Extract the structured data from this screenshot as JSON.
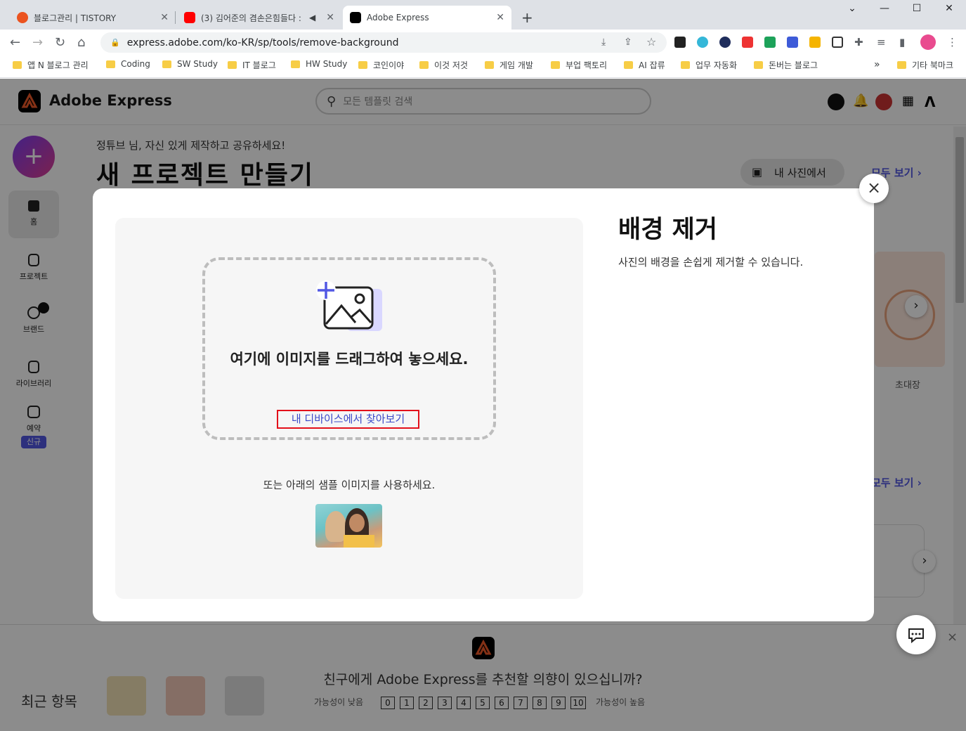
{
  "browser": {
    "tabs": [
      {
        "title": "블로그관리 | TISTORY"
      },
      {
        "title": "(3) 김어준의 겸손은힘들다 :"
      },
      {
        "title": "Adobe Express"
      }
    ],
    "new_tab": "+",
    "url": "express.adobe.com/ko-KR/sp/tools/remove-background",
    "bookmarks": [
      "앱 N 블로그 관리",
      "Coding",
      "SW Study",
      "IT 블로그",
      "HW Study",
      "코인이야",
      "이것 저것",
      "게임 개발",
      "부업 팩토리",
      "AI 잡류",
      "업무 자동화",
      "돈버는 블로그"
    ],
    "bookmarks_more": "»",
    "other_bookmarks": "기타 북마크"
  },
  "app": {
    "brand": "Adobe Express",
    "search_placeholder": "모든 템플릿 검색",
    "sidebar": {
      "create": "+",
      "items": [
        {
          "label": "홈"
        },
        {
          "label": "프로젝트"
        },
        {
          "label": "브랜드"
        },
        {
          "label": "라이브러리"
        },
        {
          "label": "예약"
        }
      ],
      "new_badge": "신규"
    },
    "greeting": "정튜브 님, 자신 있게 제작하고 공유하세요!",
    "page_title": "새 프로젝트 만들기",
    "photo_button": "내 사진에서",
    "see_all": "모두 보기 ›",
    "invite_label": "초대장",
    "recent": "최근 항목"
  },
  "modal": {
    "title": "배경 제거",
    "description": "사진의 배경을 손쉽게 제거할 수 있습니다.",
    "drop_text": "여기에 이미지를 드래그하여 놓으세요.",
    "browse_link": "내 디바이스에서 찾아보기",
    "or_text": "또는 아래의 샘플 이미지를 사용하세요.",
    "close": "×"
  },
  "survey": {
    "question": "친구에게 Adobe Express를 추천할 의향이 있으십니까?",
    "low_label": "가능성이 낮음",
    "high_label": "가능성이 높음",
    "scale": [
      "0",
      "1",
      "2",
      "3",
      "4",
      "5",
      "6",
      "7",
      "8",
      "9",
      "10"
    ],
    "close": "×"
  },
  "colors": {
    "accent": "#5258e4",
    "highlight_border": "#e3101a",
    "link": "#3b49c8"
  }
}
